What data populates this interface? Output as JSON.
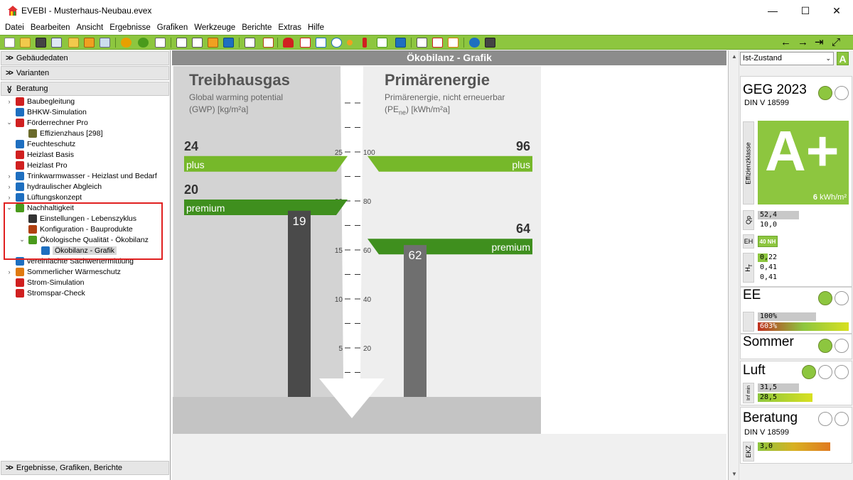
{
  "window": {
    "title": "EVEBI  - Musterhaus-Neubau.evex",
    "minimize": "—",
    "maximize": "☐",
    "close": "✕"
  },
  "menu": {
    "items": [
      "Datei",
      "Bearbeiten",
      "Ansicht",
      "Ergebnisse",
      "Grafiken",
      "Werkzeuge",
      "Berichte",
      "Extras",
      "Hilfe"
    ]
  },
  "toolbar": {
    "nav_back": "←",
    "nav_forward": "→",
    "nav_last": "⇥",
    "nav_expand": "⤢"
  },
  "left_panel": {
    "sections": {
      "gebaeudedaten": "Gebäudedaten",
      "varianten": "Varianten",
      "beratung": "Beratung",
      "ergebnisse": "Ergebnisse, Grafiken, Berichte"
    },
    "tree": [
      {
        "label": "Baubegleitung",
        "expander": "›",
        "icon": "helmet-icon",
        "color": "#d02020"
      },
      {
        "label": "BHKW-Simulation",
        "expander": "",
        "icon": "bhkw-icon",
        "color": "#1e6fc0"
      },
      {
        "label": "Förderrechner Pro",
        "expander": "⌄",
        "icon": "calculator-icon",
        "color": "#d02020"
      },
      {
        "label": "Effizienzhaus [298]",
        "expander": "",
        "icon": "house-icon",
        "color": "#6b6b2c"
      },
      {
        "label": "Feuchteschutz",
        "expander": "",
        "icon": "drop-icon",
        "color": "#1e6fc0"
      },
      {
        "label": "Heizlast Basis",
        "expander": "",
        "icon": "heizlast-icon",
        "color": "#d02020"
      },
      {
        "label": "Heizlast Pro",
        "expander": "",
        "icon": "heizlast-icon",
        "color": "#d02020"
      },
      {
        "label": "Trinkwarmwasser - Heizlast und Bedarf",
        "expander": "›",
        "icon": "water-drop-icon",
        "color": "#1e6fc0"
      },
      {
        "label": "hydraulischer Abgleich",
        "expander": "›",
        "icon": "pipe-icon",
        "color": "#1e6fc0"
      },
      {
        "label": "Lüftungskonzept",
        "expander": "›",
        "icon": "fan-icon",
        "color": "#1e6fc0"
      },
      {
        "label": "Nachhaltigkeit",
        "expander": "⌄",
        "icon": "leaf-house-icon",
        "color": "#4a9a1c"
      },
      {
        "label": "Einstellungen - Lebenszyklus",
        "expander": "",
        "icon": "tools-icon",
        "color": "#333333"
      },
      {
        "label": "Konfiguration - Bauprodukte",
        "expander": "",
        "icon": "bricks-icon",
        "color": "#b04010"
      },
      {
        "label": "Ökologische Qualität - Ökobilanz",
        "expander": "⌄",
        "icon": "tree-icon",
        "color": "#4a9a1c"
      },
      {
        "label": "Ökobilanz - Grafik",
        "expander": "",
        "icon": "chart-icon",
        "color": "#1e6fc0"
      },
      {
        "label": "vereinfachte Sachwertermittlung",
        "expander": "",
        "icon": "euro-icon",
        "color": "#1e6fc0"
      },
      {
        "label": "Sommerlicher Wärmeschutz",
        "expander": "›",
        "icon": "sun-icon",
        "color": "#e07a10"
      },
      {
        "label": "Strom-Simulation",
        "expander": "",
        "icon": "strom-icon",
        "color": "#d02020"
      },
      {
        "label": "Stromspar-Check",
        "expander": "",
        "icon": "lightning-icon",
        "color": "#d02020"
      }
    ]
  },
  "center": {
    "header": "Ökobilanz - Grafik",
    "left_title": "Treibhausgas",
    "left_sub1": "Global warming potential",
    "left_sub2": "(GWP) [kg/m²a]",
    "right_title": "Primärenergie",
    "right_sub1": "Primärenergie, nicht erneuerbar",
    "right_sub2_main": "(PE",
    "right_sub2_index": "ne",
    "right_sub2_unit": ") [kWh/m²a]",
    "colors": {
      "plus": "#76b82a",
      "premium": "#3f8f1e",
      "bar_left": "#4a4a4a",
      "bar_right": "#6f6f6f"
    }
  },
  "chart_data": {
    "type": "bar",
    "title": "Ökobilanz - Grafik",
    "series": [
      {
        "name": "Treibhausgas",
        "value": 19,
        "thresholds": [
          {
            "label": "plus",
            "value": 24
          },
          {
            "label": "premium",
            "value": 20
          }
        ],
        "ylim": [
          0,
          30
        ]
      },
      {
        "name": "Primärenergie",
        "value": 62,
        "thresholds": [
          {
            "label": "plus",
            "value": 96
          },
          {
            "label": "premium",
            "value": 64
          }
        ],
        "ylim": [
          0,
          120
        ]
      }
    ],
    "left_ticks": [
      5,
      10,
      15,
      20,
      25
    ],
    "right_ticks": [
      20,
      40,
      60,
      80,
      100
    ],
    "plus_label": "plus",
    "premium_label": "premium",
    "left_value_label": "19",
    "right_value_label": "62",
    "left_plus_value": "24",
    "left_premium_value": "20",
    "right_plus_value": "96",
    "right_premium_value": "64"
  },
  "right_panel": {
    "dropdown": "Ist-Zustand",
    "badge": "A",
    "geg": {
      "title": "GEG 2023",
      "sub": "DIN V 18599",
      "class_label": "Effizienzklasse",
      "class": "A+",
      "value": "6",
      "unit": "kWh/m²"
    },
    "qp": {
      "label": "Qp",
      "v1": "52,4",
      "v2": "10,0"
    },
    "eh": {
      "label": "EH",
      "badge": "40 NH"
    },
    "ht": {
      "label": "H",
      "sub": "T",
      "v1": "0,22",
      "v2": "0,41",
      "v3": "0,41"
    },
    "ee": {
      "title": "EE",
      "v1": "100%",
      "v2": "603%"
    },
    "sommer": {
      "title": "Sommer"
    },
    "luft": {
      "title": "Luft",
      "label": "Inf min",
      "v1": "31,5",
      "v2": "28,5"
    },
    "beratung": {
      "title": "Beratung",
      "sub": "DIN V 18599",
      "label": "EKZ",
      "v1": "3,0"
    },
    "accent": "#8dc63f"
  }
}
